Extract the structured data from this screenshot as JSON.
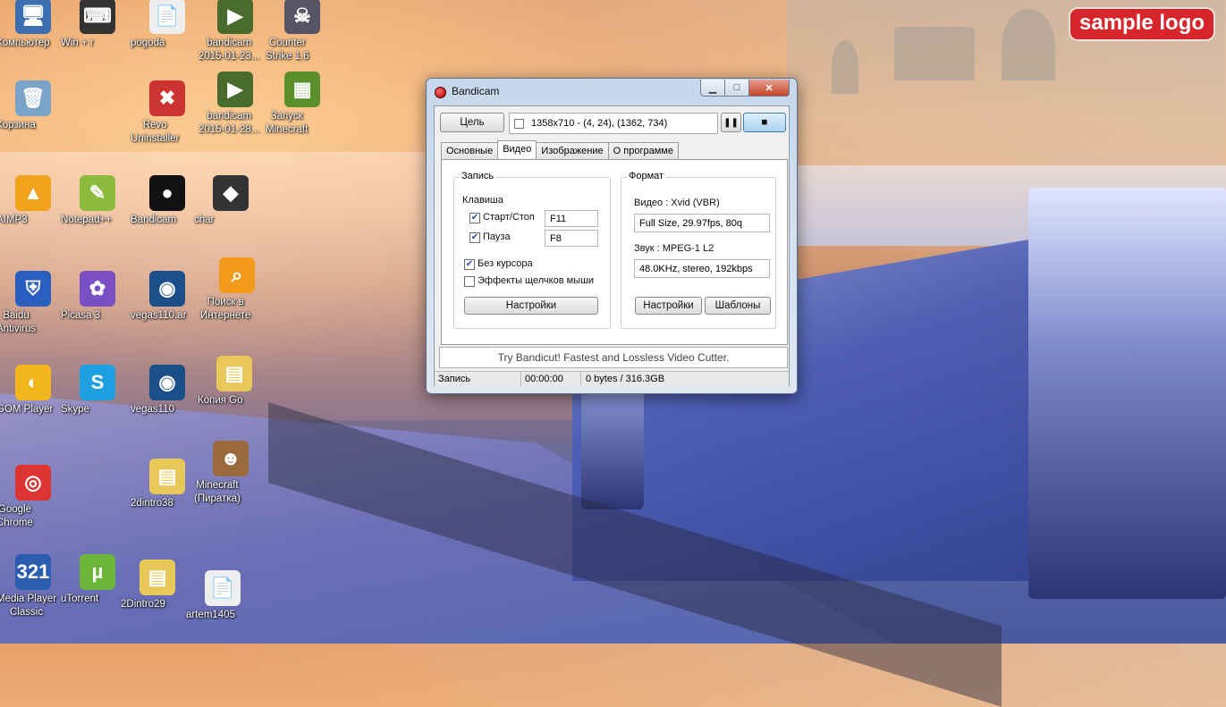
{
  "logo": {
    "text": "sample logo"
  },
  "desktop_icons": [
    {
      "label": "Компьютер",
      "glyph": "🖥",
      "color": "#3b6fb0"
    },
    {
      "label": "Win + r",
      "glyph": "⌨",
      "color": "#333"
    },
    {
      "label": "pogoda",
      "glyph": "📄",
      "color": "#eee"
    },
    {
      "label": "bandicam\n2015-01-23...",
      "glyph": "▶",
      "color": "#4a6b2e"
    },
    {
      "label": "Counter\nStrike 1.6",
      "glyph": "☠",
      "color": "#556"
    },
    {
      "label": "Корзина",
      "glyph": "🗑",
      "color": "#7aa3c8"
    },
    {
      "label": "Revo\nUninstaller",
      "glyph": "✖",
      "color": "#c33"
    },
    {
      "label": "bandicam\n2015-01-28...",
      "glyph": "▶",
      "color": "#4a6b2e"
    },
    {
      "label": "Запуск\nMinecraft",
      "glyph": "▦",
      "color": "#5a8f2c"
    },
    {
      "label": "AIMP3",
      "glyph": "▲",
      "color": "#f1a21b"
    },
    {
      "label": "Notepad++",
      "glyph": "✎",
      "color": "#8dbb3e"
    },
    {
      "label": "Bandicam",
      "glyph": "●",
      "color": "#111"
    },
    {
      "label": "char",
      "glyph": "◆",
      "color": "#333"
    },
    {
      "label": "Baidu\nAntivirus",
      "glyph": "⛨",
      "color": "#2b5fbf"
    },
    {
      "label": "Picasa 3",
      "glyph": "✿",
      "color": "#7b4fc4"
    },
    {
      "label": "vegas110.ar",
      "glyph": "◉",
      "color": "#1b4f8a"
    },
    {
      "label": "Поиск в\nИнтернете",
      "glyph": "⌕",
      "color": "#f29a1c"
    },
    {
      "label": "GOM Player",
      "glyph": "◐",
      "color": "#f2b51c"
    },
    {
      "label": "Skype",
      "glyph": "S",
      "color": "#1ea0e0"
    },
    {
      "label": "vegas110",
      "glyph": "◉",
      "color": "#1b4f8a"
    },
    {
      "label": "Копия Go",
      "glyph": "▤",
      "color": "#e9c85a"
    },
    {
      "label": "Google\nChrome",
      "glyph": "◎",
      "color": "#d33"
    },
    {
      "label": "2dintro38",
      "glyph": "▤",
      "color": "#e9c85a"
    },
    {
      "label": "Minecraft\n(Пиратка)",
      "glyph": "☻",
      "color": "#9a6a3a"
    },
    {
      "label": "Media Player\nClassic",
      "glyph": "321",
      "color": "#2a5db0"
    },
    {
      "label": "uTorrent",
      "glyph": "µ",
      "color": "#6bb53a"
    },
    {
      "label": "2Dintro29",
      "glyph": "▤",
      "color": "#e9c85a"
    },
    {
      "label": "artem1405",
      "glyph": "📄",
      "color": "#eee"
    }
  ],
  "window": {
    "title": "Bandicam",
    "target_button": "Цель",
    "target_info": "1358x710 - (4, 24), (1362, 734)",
    "pause_glyph": "❚❚",
    "stop_glyph": "■",
    "tabs": [
      "Основные",
      "Видео",
      "Изображение",
      "О программе"
    ],
    "active_tab": "Видео",
    "record_group": {
      "title": "Запись",
      "hotkey_label": "Клавиша",
      "start_stop_label": "Старт/Стоп",
      "start_stop_key": "F11",
      "start_stop_checked": true,
      "pause_label": "Пауза",
      "pause_key": "F8",
      "pause_checked": true,
      "no_cursor_label": "Без курсора",
      "no_cursor_checked": true,
      "mouse_effects_label": "Эффекты щелчков мыши",
      "mouse_effects_checked": false,
      "settings_button": "Настройки"
    },
    "format_group": {
      "title": "Формат",
      "video_label": "Видео : Xvid (VBR)",
      "video_value": "Full Size, 29.97fps, 80q",
      "audio_label": "Звук : MPEG-1 L2",
      "audio_value": "48.0KHz, stereo, 192kbps",
      "settings_button": "Настройки",
      "templates_button": "Шаблоны"
    },
    "promo": "Try Bandicut! Fastest and Lossless Video Cutter.",
    "status": {
      "state": "Запись",
      "time": "00:00:00",
      "size": "0 bytes / 316.3GB"
    }
  }
}
